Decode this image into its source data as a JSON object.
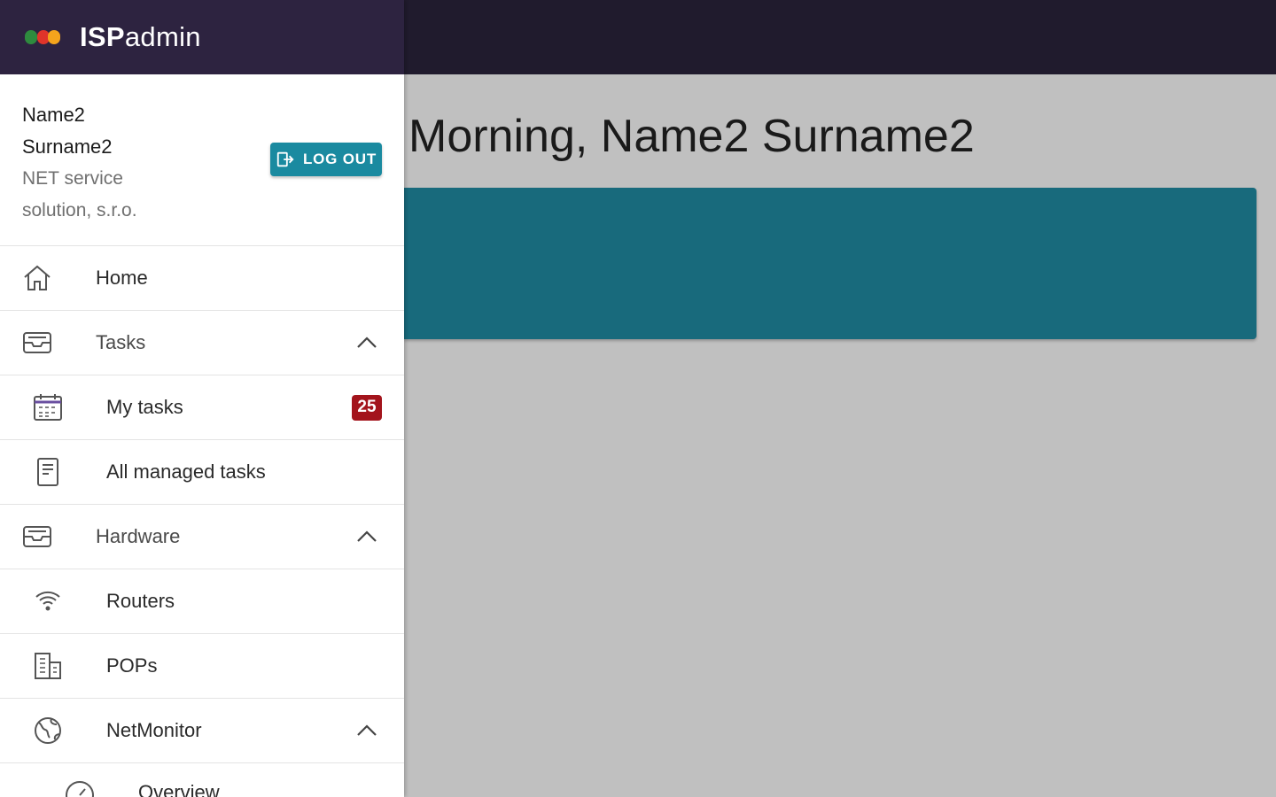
{
  "app": {
    "brand_bold": "ISP",
    "brand_light": "admin"
  },
  "user": {
    "first_name": "Name2",
    "last_name": "Surname2",
    "company_line1": "NET service",
    "company_line2": "solution, s.r.o.",
    "logout_label": "LOG OUT"
  },
  "greeting": "Morning, Name2 Surname2",
  "menu": {
    "home": "Home",
    "tasks": "Tasks",
    "my_tasks": "My tasks",
    "my_tasks_badge": "25",
    "all_managed_tasks": "All managed tasks",
    "hardware": "Hardware",
    "routers": "Routers",
    "pops": "POPs",
    "netmonitor": "NetMonitor",
    "overview": "Overview"
  },
  "colors": {
    "appbar": "#201b2d",
    "drawer_header": "#2d2340",
    "accent": "#1a8aa0",
    "banner": "#186a7c",
    "badge": "#a3141c",
    "logo_green": "#2e8b3e",
    "logo_red": "#e0342a",
    "logo_orange": "#f4a41c"
  }
}
